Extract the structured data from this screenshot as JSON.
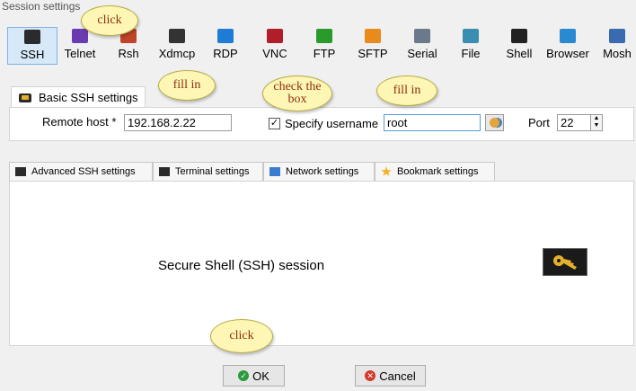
{
  "window": {
    "title": "Session settings"
  },
  "session_types": [
    {
      "label": "SSH",
      "icon": "key-icon",
      "color": "#2b2b2b"
    },
    {
      "label": "Telnet",
      "icon": "telnet-icon",
      "color": "#6a3bb0"
    },
    {
      "label": "Rsh",
      "icon": "rsh-icon",
      "color": "#c0442a"
    },
    {
      "label": "Xdmcp",
      "icon": "xdmcp-icon",
      "color": "#333333"
    },
    {
      "label": "RDP",
      "icon": "rdp-icon",
      "color": "#1e7bd6"
    },
    {
      "label": "VNC",
      "icon": "vnc-icon",
      "color": "#b01e2a"
    },
    {
      "label": "FTP",
      "icon": "ftp-icon",
      "color": "#2a9a2a"
    },
    {
      "label": "SFTP",
      "icon": "sftp-icon",
      "color": "#e98a1c"
    },
    {
      "label": "Serial",
      "icon": "serial-icon",
      "color": "#6a7a8a"
    },
    {
      "label": "File",
      "icon": "file-icon",
      "color": "#3a8fb0"
    },
    {
      "label": "Shell",
      "icon": "shell-icon",
      "color": "#222222"
    },
    {
      "label": "Browser",
      "icon": "browser-icon",
      "color": "#2a8ad0"
    },
    {
      "label": "Mosh",
      "icon": "mosh-icon",
      "color": "#3a6ab0"
    }
  ],
  "basic_tab": {
    "label": "Basic SSH settings",
    "remote_host_label": "Remote host *",
    "remote_host_value": "192.168.2.22",
    "specify_username_label": "Specify username",
    "specify_username_checked": true,
    "username_value": "root",
    "port_label": "Port",
    "port_value": "22"
  },
  "lower_tabs": [
    {
      "label": "Advanced SSH settings",
      "icon": "key-icon"
    },
    {
      "label": "Terminal settings",
      "icon": "terminal-icon"
    },
    {
      "label": "Network settings",
      "icon": "network-icon"
    },
    {
      "label": "Bookmark settings",
      "icon": "star-icon"
    }
  ],
  "session_description": "Secure Shell (SSH) session",
  "buttons": {
    "ok": "OK",
    "cancel": "Cancel"
  },
  "annotations": {
    "click_ssh": "click",
    "fill_host": "fill in",
    "check_box_line1": "check the",
    "check_box_line2": "box",
    "fill_username": "fill in",
    "click_ok": "click"
  }
}
